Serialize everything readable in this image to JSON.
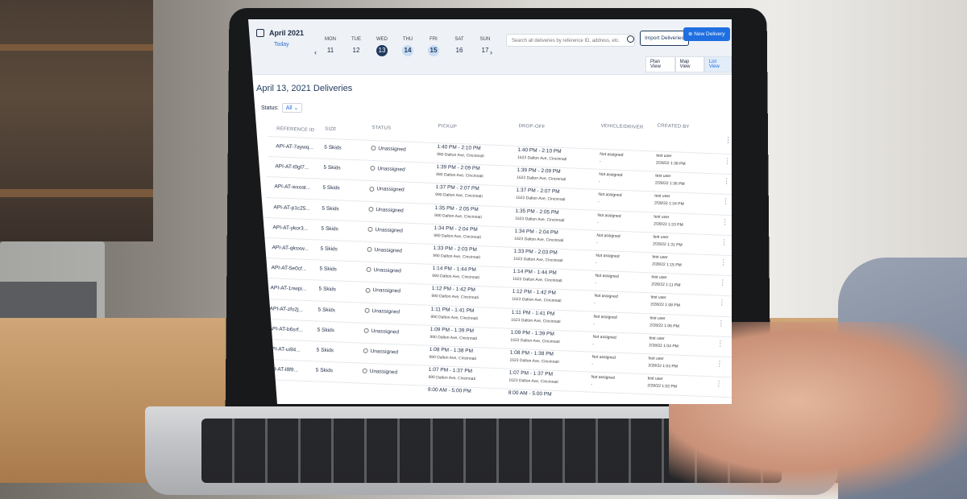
{
  "header": {
    "month": "April 2021",
    "today": "Today",
    "prev_arrow": "‹",
    "next_arrow": "›",
    "days": [
      {
        "dow": "MON",
        "num": "11"
      },
      {
        "dow": "TUE",
        "num": "12"
      },
      {
        "dow": "WED",
        "num": "13"
      },
      {
        "dow": "THU",
        "num": "14"
      },
      {
        "dow": "FRI",
        "num": "15"
      },
      {
        "dow": "SAT",
        "num": "16"
      },
      {
        "dow": "SUN",
        "num": "17"
      }
    ],
    "search_placeholder": "Search all deliveries by reference ID, address, etc.",
    "import_label": "Import Deliveries",
    "new_label": "⊕ New Delivery",
    "views": [
      "Plan View",
      "Map View",
      "List View"
    ]
  },
  "page": {
    "title": "April 13, 2021 Deliveries",
    "status_label": "Status:",
    "status_value": "All"
  },
  "table": {
    "columns": {
      "ref": "REFERENCE ID",
      "size": "SIZE",
      "status": "STATUS",
      "pickup": "PICKUP",
      "dropoff": "DROP-OFF",
      "vehicle": "VEHICLE/DRIVER",
      "created": "CREATED BY"
    },
    "rows": [
      {
        "ref": "API-AT-7aywq...",
        "size": "5 Skids",
        "status": "Unassigned",
        "pickup": "1:40 PM - 2:10 PM",
        "pickup_addr": "990 Dalton Ave, Cincinnati",
        "dropoff": "1:40 PM - 2:10 PM",
        "dropoff_addr": "1623 Dalton Ave, Cincinnati",
        "vehicle": "Not assigned",
        "vehicle_sub": "-",
        "created_by": "test user",
        "created_date": "2/28/22 1:38 PM"
      },
      {
        "ref": "API-AT-t0gl7...",
        "size": "5 Skids",
        "status": "Unassigned",
        "pickup": "1:39 PM - 2:09 PM",
        "pickup_addr": "990 Dalton Ave, Cincinnati",
        "dropoff": "1:39 PM - 2:09 PM",
        "dropoff_addr": "1623 Dalton Ave, Cincinnati",
        "vehicle": "Not assigned",
        "vehicle_sub": "-",
        "created_by": "test user",
        "created_date": "2/28/22 1:36 PM"
      },
      {
        "ref": "API-AT-wxoat...",
        "size": "5 Skids",
        "status": "Unassigned",
        "pickup": "1:37 PM - 2:07 PM",
        "pickup_addr": "990 Dalton Ave, Cincinnati",
        "dropoff": "1:37 PM - 2:07 PM",
        "dropoff_addr": "1623 Dalton Ave, Cincinnati",
        "vehicle": "Not assigned",
        "vehicle_sub": "-",
        "created_by": "test user",
        "created_date": "2/28/22 1:34 PM"
      },
      {
        "ref": "API-AT-p1c25...",
        "size": "5 Skids",
        "status": "Unassigned",
        "pickup": "1:35 PM - 2:05 PM",
        "pickup_addr": "990 Dalton Ave, Cincinnati",
        "dropoff": "1:35 PM - 2:05 PM",
        "dropoff_addr": "1623 Dalton Ave, Cincinnati",
        "vehicle": "Not assigned",
        "vehicle_sub": "-",
        "created_by": "test user",
        "created_date": "2/28/22 1:33 PM"
      },
      {
        "ref": "API-AT-ykor3...",
        "size": "5 Skids",
        "status": "Unassigned",
        "pickup": "1:34 PM - 2:04 PM",
        "pickup_addr": "990 Dalton Ave, Cincinnati",
        "dropoff": "1:34 PM - 2:04 PM",
        "dropoff_addr": "1623 Dalton Ave, Cincinnati",
        "vehicle": "Not assigned",
        "vehicle_sub": "-",
        "created_by": "test user",
        "created_date": "2/28/22 1:31 PM"
      },
      {
        "ref": "API-AT-qksxw...",
        "size": "5 Skids",
        "status": "Unassigned",
        "pickup": "1:33 PM - 2:03 PM",
        "pickup_addr": "990 Dalton Ave, Cincinnati",
        "dropoff": "1:33 PM - 2:03 PM",
        "dropoff_addr": "1623 Dalton Ave, Cincinnati",
        "vehicle": "Not assigned",
        "vehicle_sub": "-",
        "created_by": "test user",
        "created_date": "2/28/22 1:15 PM"
      },
      {
        "ref": "API-AT-5e0cf...",
        "size": "5 Skids",
        "status": "Unassigned",
        "pickup": "1:14 PM - 1:44 PM",
        "pickup_addr": "990 Dalton Ave, Cincinnati",
        "dropoff": "1:14 PM - 1:44 PM",
        "dropoff_addr": "1623 Dalton Ave, Cincinnati",
        "vehicle": "Not assigned",
        "vehicle_sub": "-",
        "created_by": "test user",
        "created_date": "2/28/22 1:11 PM"
      },
      {
        "ref": "API-AT-1nwpi...",
        "size": "5 Skids",
        "status": "Unassigned",
        "pickup": "1:12 PM - 1:42 PM",
        "pickup_addr": "990 Dalton Ave, Cincinnati",
        "dropoff": "1:12 PM - 1:42 PM",
        "dropoff_addr": "1623 Dalton Ave, Cincinnati",
        "vehicle": "Not assigned",
        "vehicle_sub": "-",
        "created_by": "test user",
        "created_date": "2/28/22 1:08 PM"
      },
      {
        "ref": "API-AT-zfo2j...",
        "size": "5 Skids",
        "status": "Unassigned",
        "pickup": "1:11 PM - 1:41 PM",
        "pickup_addr": "990 Dalton Ave, Cincinnati",
        "dropoff": "1:11 PM - 1:41 PM",
        "dropoff_addr": "1623 Dalton Ave, Cincinnati",
        "vehicle": "Not assigned",
        "vehicle_sub": "-",
        "created_by": "test user",
        "created_date": "2/28/22 1:06 PM"
      },
      {
        "ref": "API-AT-b6srf...",
        "size": "5 Skids",
        "status": "Unassigned",
        "pickup": "1:09 PM - 1:39 PM",
        "pickup_addr": "990 Dalton Ave, Cincinnati",
        "dropoff": "1:09 PM - 1:39 PM",
        "dropoff_addr": "1623 Dalton Ave, Cincinnati",
        "vehicle": "Not assigned",
        "vehicle_sub": "-",
        "created_by": "test user",
        "created_date": "2/28/22 1:04 PM"
      },
      {
        "ref": "API-AT-ui94...",
        "size": "5 Skids",
        "status": "Unassigned",
        "pickup": "1:08 PM - 1:38 PM",
        "pickup_addr": "990 Dalton Ave, Cincinnati",
        "dropoff": "1:08 PM - 1:38 PM",
        "dropoff_addr": "1623 Dalton Ave, Cincinnati",
        "vehicle": "Not assigned",
        "vehicle_sub": "-",
        "created_by": "test user",
        "created_date": "2/28/22 1:03 PM"
      },
      {
        "ref": "API-AT-l8f9...",
        "size": "5 Skids",
        "status": "Unassigned",
        "pickup": "1:07 PM - 1:37 PM",
        "pickup_addr": "990 Dalton Ave, Cincinnati",
        "dropoff": "1:07 PM - 1:37 PM",
        "dropoff_addr": "1623 Dalton Ave, Cincinnati",
        "vehicle": "Not assigned",
        "vehicle_sub": "-",
        "created_by": "test user",
        "created_date": "2/28/22 1:02 PM"
      },
      {
        "ref": "",
        "size": "",
        "status": "",
        "pickup": "8:00 AM - 5:00 PM",
        "pickup_addr": "",
        "dropoff": "8:00 AM - 5:00 PM",
        "dropoff_addr": "",
        "vehicle": "",
        "vehicle_sub": "",
        "created_by": "",
        "created_date": ""
      }
    ]
  }
}
